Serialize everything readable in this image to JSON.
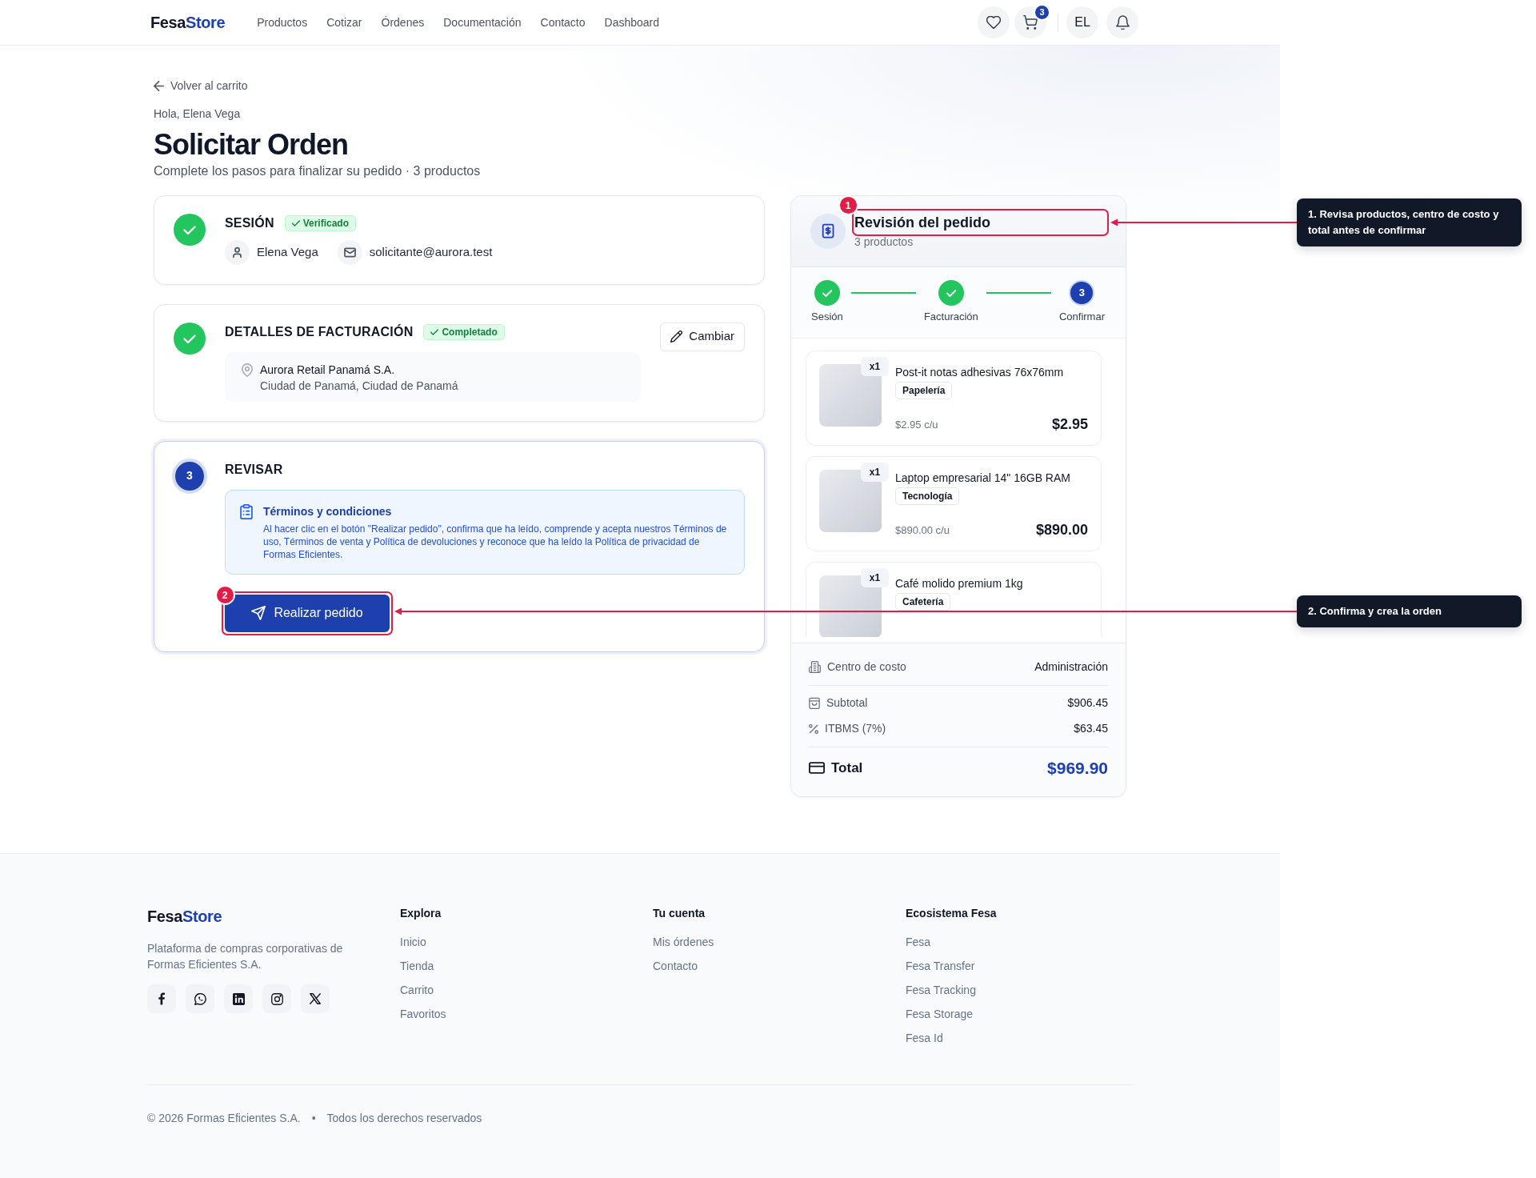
{
  "header": {
    "logo": {
      "text": "Fesa",
      "accent": "Store"
    },
    "nav": [
      "Productos",
      "Cotizar",
      "Órdenes",
      "Documentación",
      "Contacto",
      "Dashboard"
    ],
    "cart_count": "3",
    "avatar": "EL"
  },
  "back_link": "Volver al carrito",
  "greeting": "Hola, Elena Vega",
  "title": "Solicitar Orden",
  "subtitle": "Complete los pasos para finalizar su pedido · 3 productos",
  "steps": [
    {
      "kind": "session",
      "completed": true,
      "active": false,
      "title": "SESIÓN",
      "badge": "Verificado",
      "user_name": "Elena Vega",
      "email": "solicitante@aurora.test"
    },
    {
      "kind": "billing",
      "completed": true,
      "active": false,
      "title": "DETALLES DE FACTURACIÓN",
      "badge": "Completado",
      "button": "Cambiar",
      "company": "Aurora Retail Panamá S.A.",
      "city": "Ciudad de Panamá, Ciudad de Panamá"
    },
    {
      "kind": "review",
      "completed": false,
      "active": true,
      "number": "3",
      "title": "REVISAR",
      "terms_title": "Términos y condiciones",
      "terms_text": "Al hacer clic en el botón \"Realizar pedido\", confirma que ha leído, comprende y acepta nuestros Términos de uso, Términos de venta y Política de devoluciones y reconoce que ha leído la Política de privacidad de Formas Eficientes.",
      "button": "Realizar pedido"
    }
  ],
  "summary": {
    "title": "Revisión del pedido",
    "subtitle": "3 productos",
    "progress": [
      {
        "label": "Sesión",
        "completed": true
      },
      {
        "label": "Facturación",
        "completed": true
      },
      {
        "label": "Confirmar",
        "completed": false,
        "number": "3"
      }
    ],
    "items": [
      {
        "quantity": "x1",
        "name": "Post-it notas adhesivas 76x76mm",
        "category": "Papelería",
        "unit_price": "$2.95 c/u",
        "price": "$2.95"
      },
      {
        "quantity": "x1",
        "name": "Laptop empresarial 14\" 16GB RAM",
        "category": "Tecnología",
        "unit_price": "$890.00 c/u",
        "price": "$890.00"
      },
      {
        "quantity": "x1",
        "name": "Café molido premium 1kg",
        "category": "Cafetería"
      }
    ],
    "rows": [
      {
        "kind": "cost_center",
        "label": "Centro de costo",
        "value": "Administración"
      },
      {
        "kind": "subtotal",
        "label": "Subtotal",
        "value": "$906.45"
      },
      {
        "kind": "tax",
        "label": "ITBMS (7%)",
        "value": "$63.45"
      },
      {
        "kind": "total",
        "label": "Total",
        "value": "$969.90"
      }
    ]
  },
  "annotations": [
    {
      "number": "1",
      "text": "1. Revisa productos, centro de costo y total antes de confirmar"
    },
    {
      "number": "2",
      "text": "2. Confirma y crea la orden"
    }
  ],
  "footer": {
    "logo": {
      "text": "Fesa",
      "accent": "Store"
    },
    "description": "Plataforma de compras corporativas de Formas Eficientes S.A.",
    "columns": [
      {
        "title": "Explora",
        "links": [
          "Inicio",
          "Tienda",
          "Carrito",
          "Favoritos"
        ]
      },
      {
        "title": "Tu cuenta",
        "links": [
          "Mis órdenes",
          "Contacto"
        ]
      },
      {
        "title": "Ecosistema Fesa",
        "links": [
          "Fesa",
          "Fesa Transfer",
          "Fesa Tracking",
          "Fesa Storage",
          "Fesa Id"
        ]
      }
    ],
    "copyright": "© 2026 Formas Eficientes S.A.",
    "separator": "•",
    "rights": "Todos los derechos reservados"
  }
}
